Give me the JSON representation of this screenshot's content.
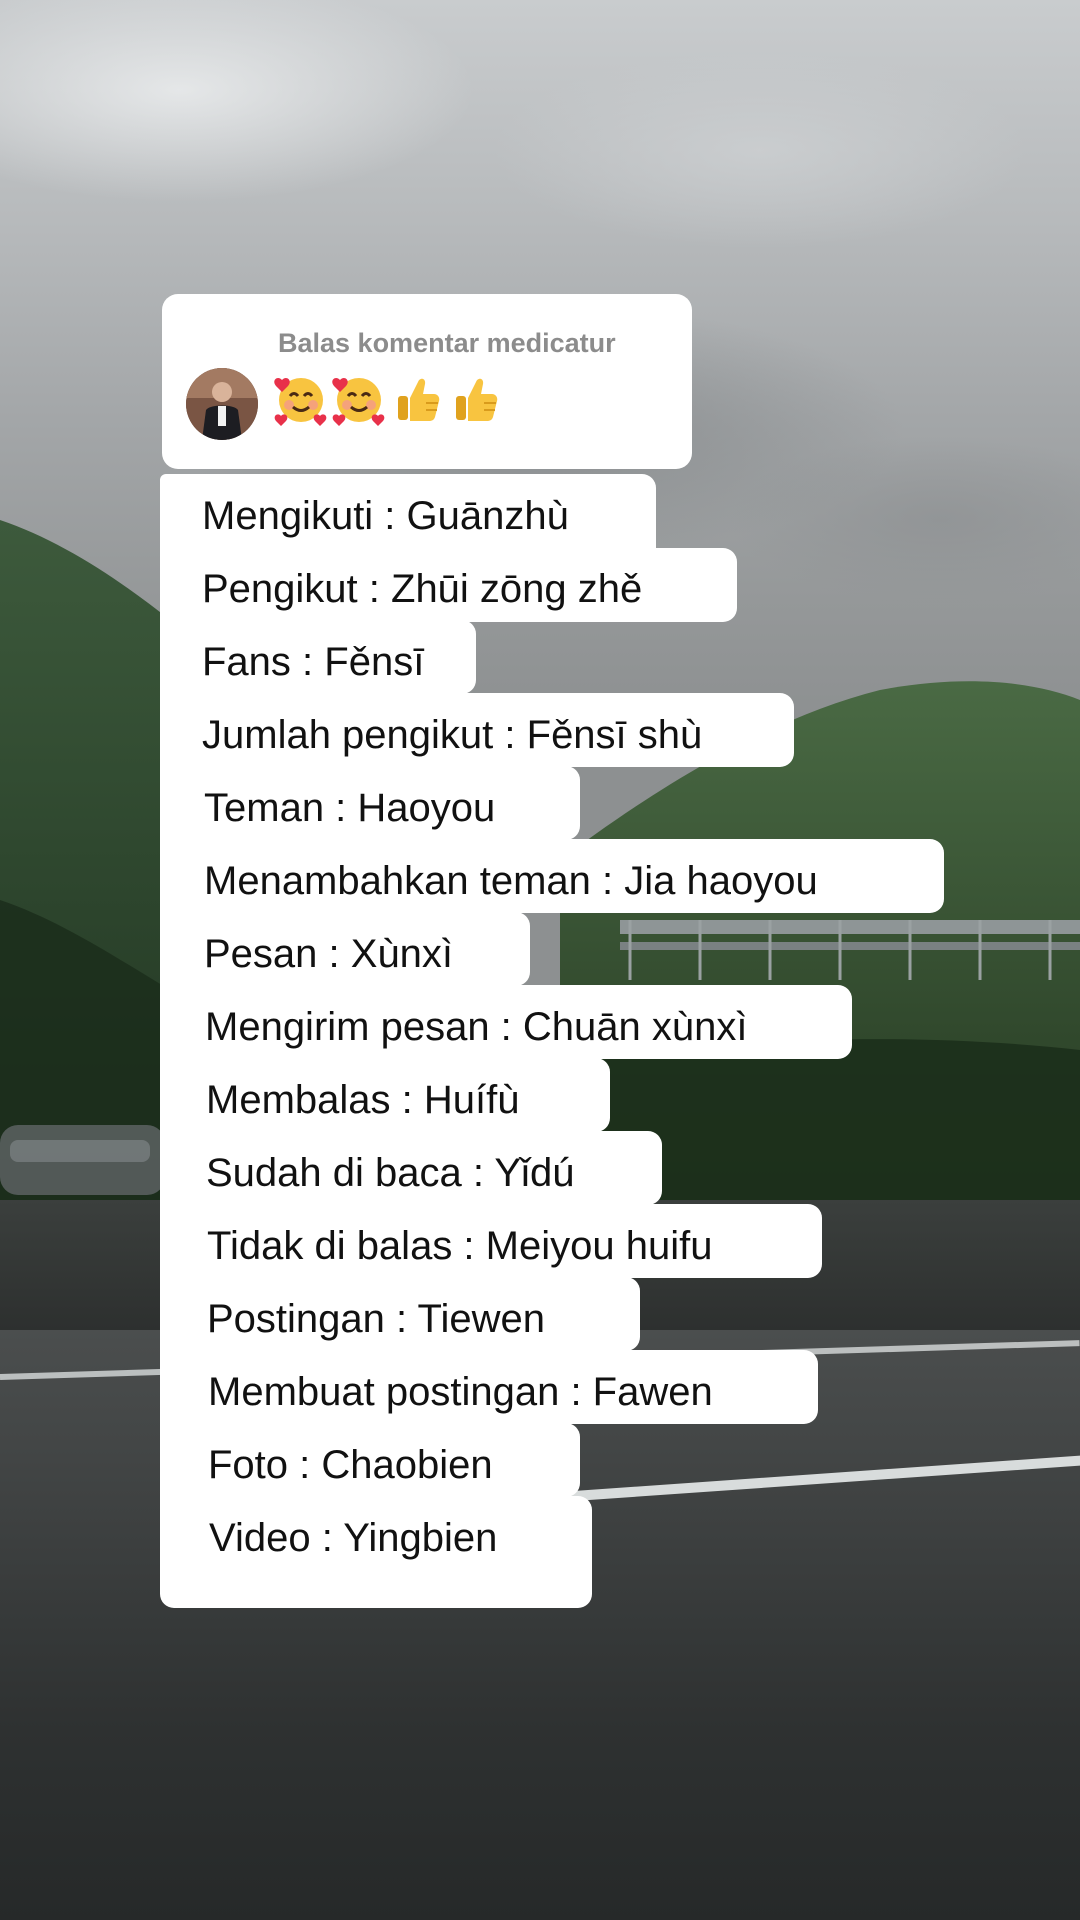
{
  "reply": {
    "title": "Balas komentar medicatur",
    "emojis": [
      "smiling-face-with-hearts-icon",
      "smiling-face-with-hearts-icon",
      "thumbs-up-icon",
      "thumbs-up-icon"
    ]
  },
  "lines": [
    "Mengikuti : Guānzhù",
    "Pengikut : Zhūi zōng zhě",
    "Fans : Fěnsī",
    "Jumlah pengikut : Fěnsī shù",
    "Teman : Haoyou",
    "Menambahkan teman : Jia haoyou",
    "Pesan : Xùnxì",
    "Mengirim pesan : Chuān xùnxì",
    "Membalas : Huífù",
    "Sudah di baca : Yǐdú",
    "Tidak di balas : Meiyou huifu",
    "Postingan : Tiewen",
    "Membuat postingan : Fawen",
    "Foto : Chaobien",
    "Video : Yingbien"
  ],
  "colors": {
    "card": "#ffffff",
    "text": "#111111",
    "reply_title": "#8c8c8c"
  }
}
